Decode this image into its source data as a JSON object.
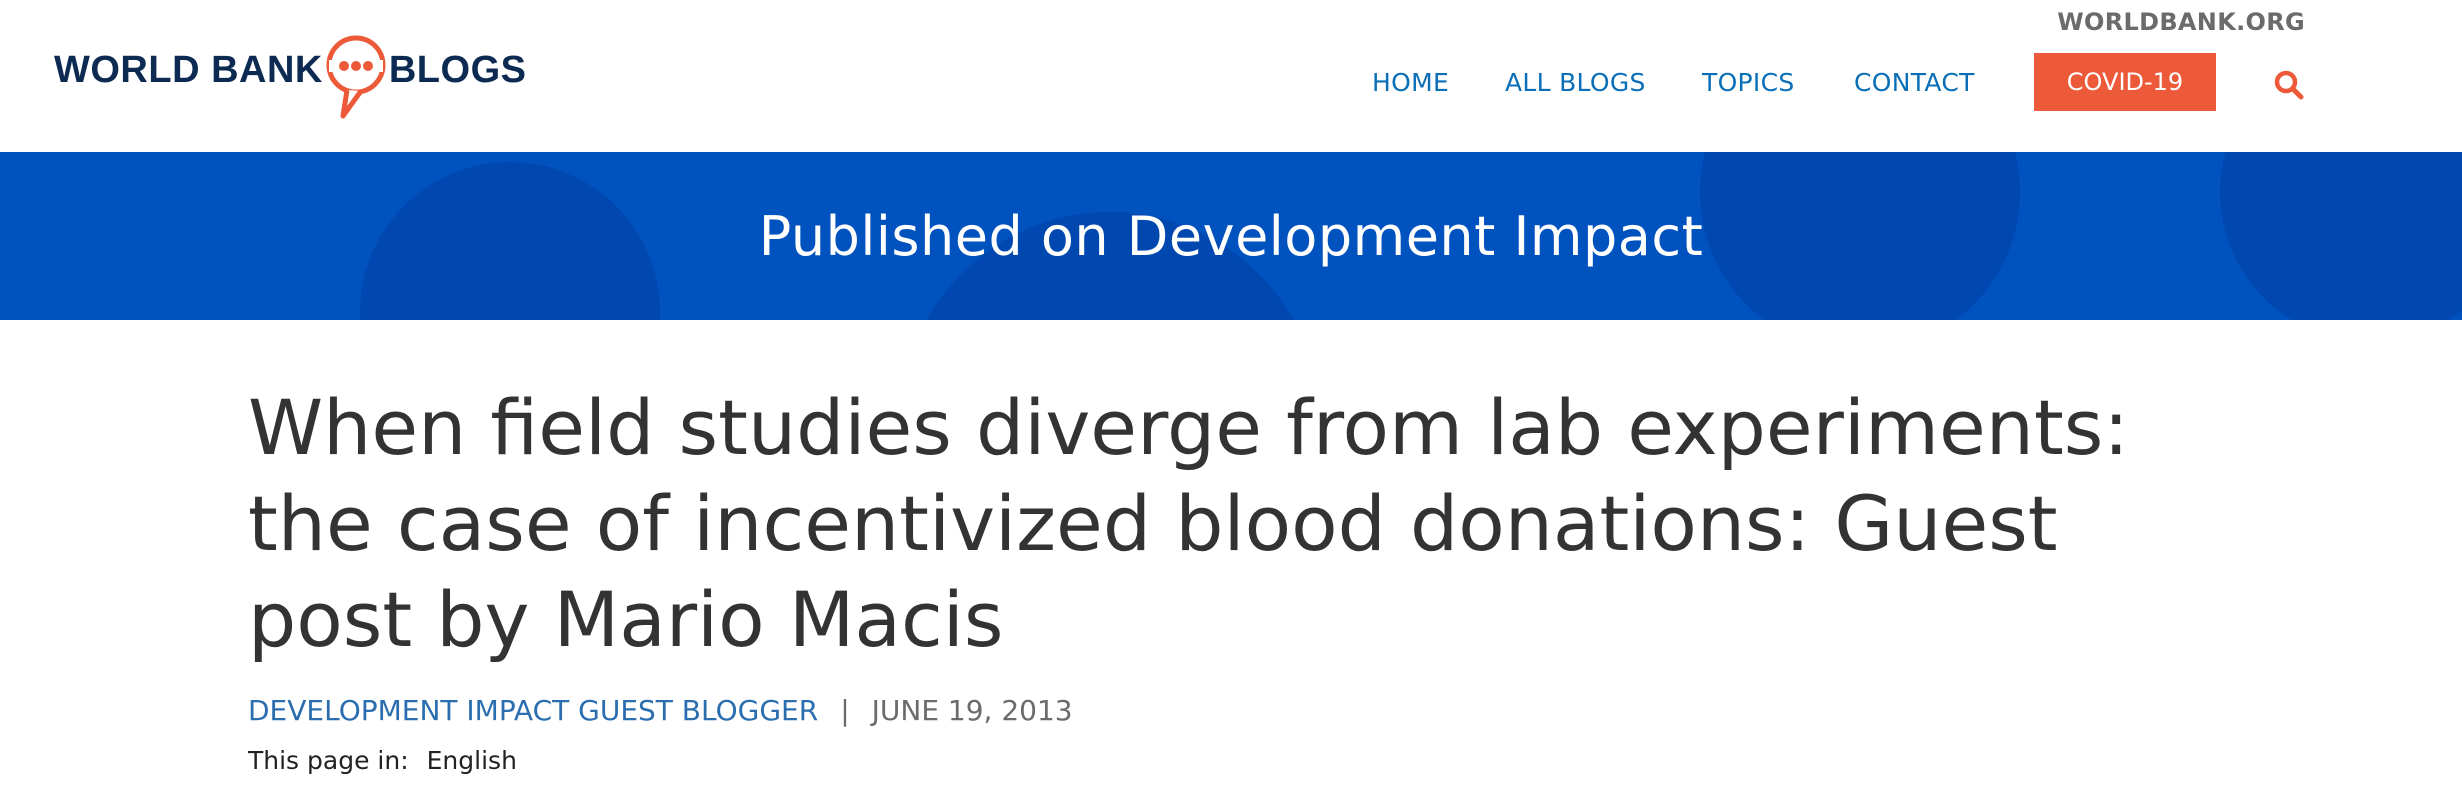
{
  "header": {
    "logo": {
      "left": "WORLD BANK",
      "right": "BLOGS"
    },
    "top_link": "WORLDBANK.ORG",
    "nav": {
      "home": "HOME",
      "all_blogs": "ALL BLOGS",
      "topics": "TOPICS",
      "contact": "CONTACT",
      "covid": "COVID-19"
    },
    "icons": {
      "search": "search-icon",
      "logo_bubble": "speech-bubble-icon"
    },
    "colors": {
      "brand_navy": "#0d2b52",
      "accent_orange": "#ec5a39",
      "nav_blue": "#0a6fb7",
      "banner_blue": "#0052bf"
    }
  },
  "banner": {
    "text": "Published on Development Impact"
  },
  "article": {
    "title": "When field studies diverge from lab experiments: the case of incentivized blood donations: Guest post by Mario Macis",
    "author": "DEVELOPMENT IMPACT GUEST BLOGGER",
    "separator": "|",
    "date": "JUNE 19, 2013",
    "language_label": "This page in:",
    "language_value": "English"
  }
}
